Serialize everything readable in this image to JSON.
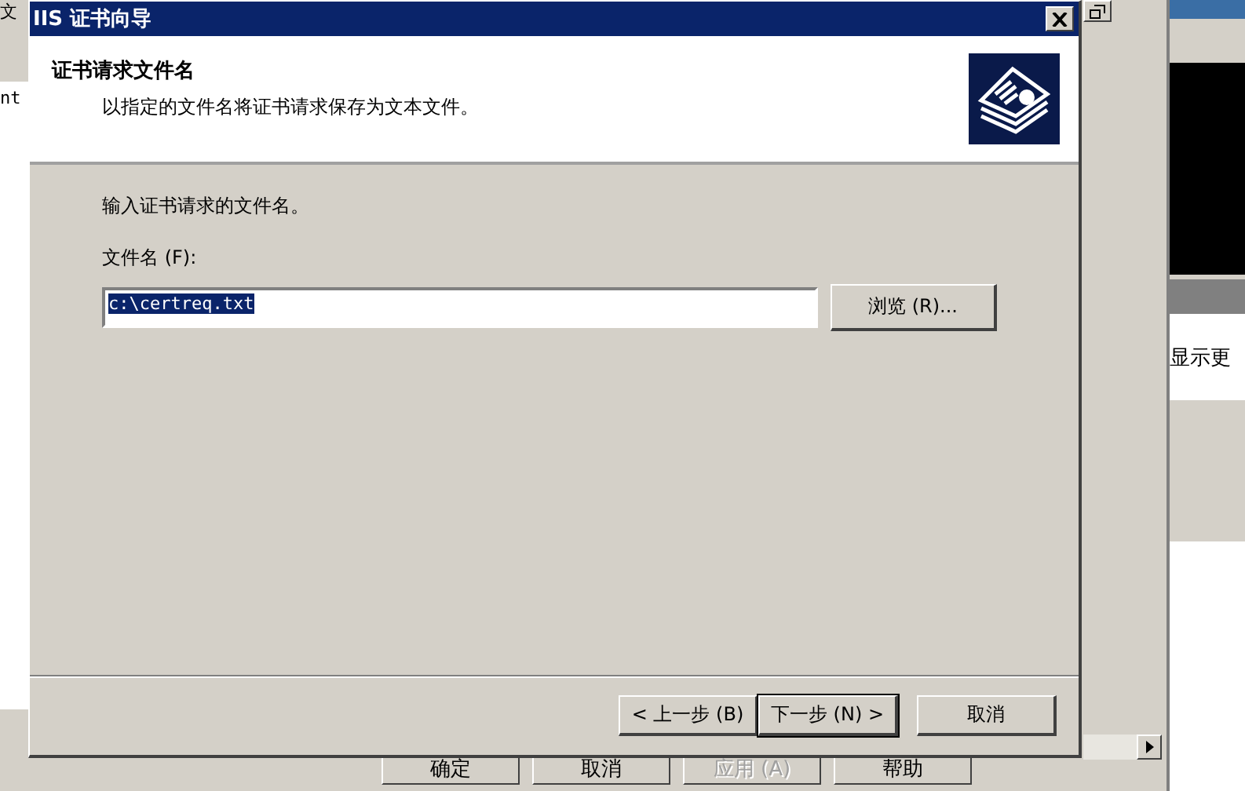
{
  "background": {
    "menu_text": "文",
    "tree_text": "nt",
    "side_text": "显示更",
    "buttons": [
      {
        "label": "确定",
        "disabled": false
      },
      {
        "label": "取消",
        "disabled": false
      },
      {
        "label": "应用 (A)",
        "disabled": true
      },
      {
        "label": "帮助",
        "disabled": false
      }
    ]
  },
  "window": {
    "title": "IIS 证书向导"
  },
  "header": {
    "title": "证书请求文件名",
    "subtitle": "以指定的文件名将证书请求保存为文本文件。"
  },
  "prompt": "输入证书请求的文件名。",
  "file_field": {
    "label": "文件名 (F):",
    "value": "c:\\certreq.txt",
    "text_selected": true
  },
  "browse_button": "浏览 (R)...",
  "buttons": [
    {
      "label": "< 上一步 (B)",
      "default": false
    },
    {
      "label": "下一步 (N) >",
      "default": true
    },
    {
      "label": "取消",
      "default": false
    }
  ]
}
